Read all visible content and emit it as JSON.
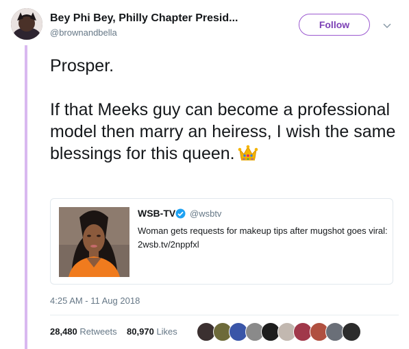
{
  "author": {
    "display_name": "Bey Phi Bey, Philly Chapter Presid...",
    "handle": "@brownandbella"
  },
  "follow_label": "Follow",
  "tweet": {
    "text": "Prosper.\n\nIf that Meeks guy can become a professional model then marry an heiress, I wish the same blessings for this queen.",
    "emoji": "crown"
  },
  "quoted": {
    "name": "WSB-TV",
    "handle": "@wsbtv",
    "verified": true,
    "text": "Woman gets requests for makeup tips after mugshot goes viral: 2wsb.tv/2nppfxl"
  },
  "timestamp": "4:25 AM - 11 Aug 2018",
  "stats": {
    "retweets_count": "28,480",
    "retweets_label": "Retweets",
    "likes_count": "80,970",
    "likes_label": "Likes"
  },
  "likers": [
    {
      "color": "#3b3030"
    },
    {
      "color": "#6d6a3a"
    },
    {
      "color": "#3a56a8"
    },
    {
      "color": "#8a8a8a"
    },
    {
      "color": "#1e1e1e"
    },
    {
      "color": "#c2b8b0"
    },
    {
      "color": "#a0384a"
    },
    {
      "color": "#b05040"
    },
    {
      "color": "#6a6f78"
    },
    {
      "color": "#2c2c2c"
    }
  ],
  "colors": {
    "accent": "#9b59d0",
    "thread_line": "#d9b8f0",
    "verified": "#1da1f2"
  }
}
